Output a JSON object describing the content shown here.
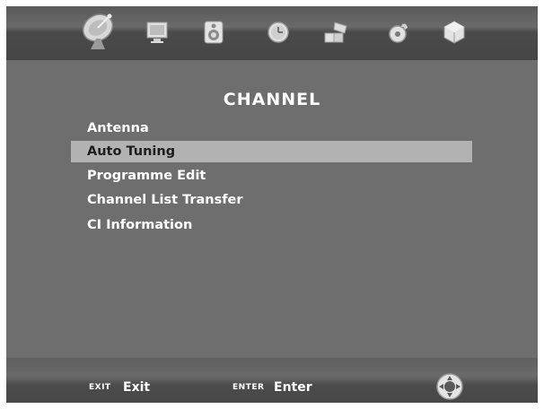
{
  "header": {
    "icons": [
      "satellite-dish-icon",
      "monitor-icon",
      "speaker-icon",
      "clock-icon",
      "settings-blocks-icon",
      "lock-icon",
      "usb-icon"
    ]
  },
  "menu": {
    "title": "CHANNEL",
    "items": [
      {
        "label": "Antenna",
        "selected": false
      },
      {
        "label": "Auto Tuning",
        "selected": true
      },
      {
        "label": "Programme Edit",
        "selected": false
      },
      {
        "label": "Channel List Transfer",
        "selected": false
      },
      {
        "label": "CI Information",
        "selected": false
      }
    ]
  },
  "footer": {
    "exit_key": "EXIT",
    "exit_label": "Exit",
    "enter_key": "ENTER",
    "enter_label": "Enter",
    "nav_icon": "navigation-pad-icon"
  },
  "colors": {
    "background": "#6e6e6e",
    "highlight": "#b2b2b2",
    "text": "#ffffff"
  }
}
